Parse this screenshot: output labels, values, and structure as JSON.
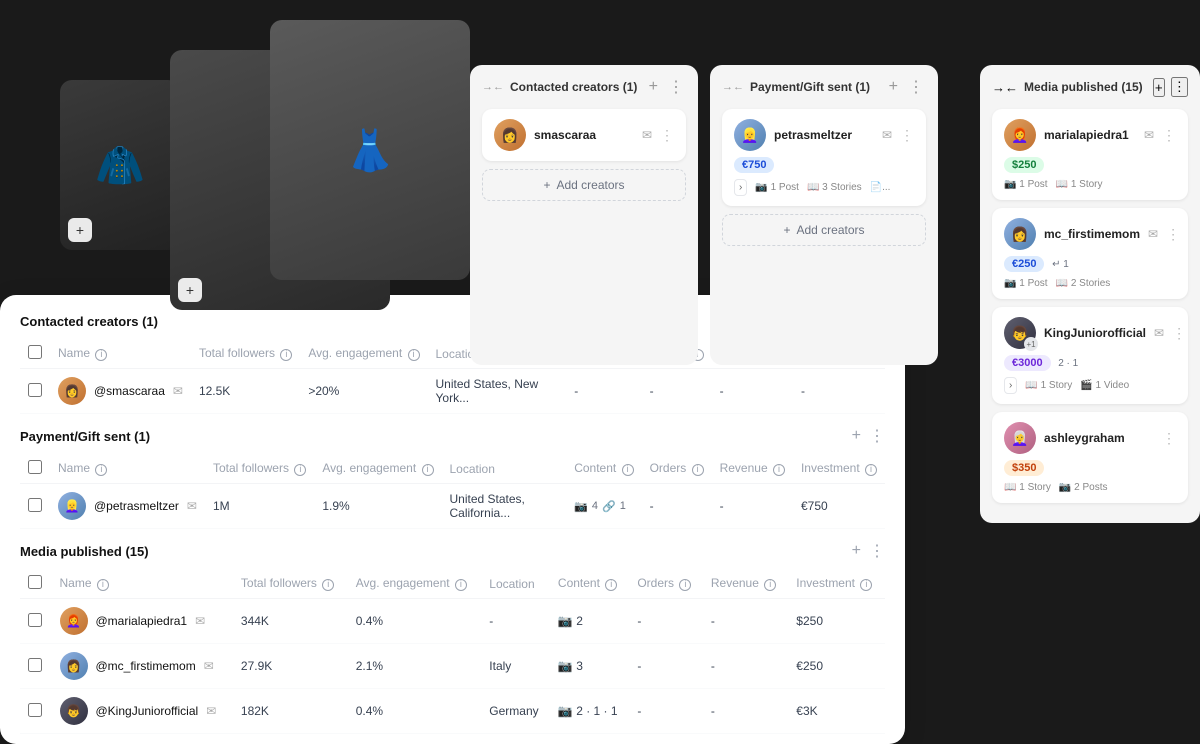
{
  "kanban": {
    "columns": [
      {
        "id": "contacted",
        "title": "Contacted creators (1)",
        "cards": [
          {
            "handle": "smascaraa",
            "avatarClass": "avatar-orange",
            "emoji": "👩"
          }
        ],
        "add_label": "Add creators"
      },
      {
        "id": "payment",
        "title": "Payment/Gift sent (1)",
        "cards": [
          {
            "handle": "petrasmeltzer",
            "avatarClass": "avatar-blue",
            "emoji": "👱‍♀️",
            "tag": "€750",
            "tagClass": "tag-blue",
            "meta": [
              "1 Post",
              "3 Stories"
            ]
          }
        ],
        "add_label": "Add creators"
      }
    ]
  },
  "right_panel": {
    "title": "Media published (15)",
    "cards": [
      {
        "handle": "marialapiedra1",
        "avatarClass": "avatar-orange",
        "emoji": "👩‍🦰",
        "tag": "$250",
        "tagClass": "tag-green",
        "meta": [
          "1 Post",
          "1 Story"
        ]
      },
      {
        "handle": "mc_firstimemom",
        "avatarClass": "avatar-blue",
        "emoji": "👩",
        "tag": "€250",
        "tagClass": "tag-blue",
        "badge": "1",
        "meta": [
          "1 Post",
          "2 Stories"
        ]
      },
      {
        "handle": "KingJuniorofficial",
        "avatarClass": "avatar-dark",
        "emoji": "👦",
        "tag": "€3000",
        "tagClass": "tag-purple",
        "counts": "2 · 1",
        "meta": [
          "1 Story",
          "1 Video"
        ]
      },
      {
        "handle": "ashleygraham",
        "avatarClass": "avatar-pink",
        "emoji": "👩‍🦳",
        "tag": "$350",
        "tagClass": "tag-orange",
        "meta": [
          "1 Story",
          "2 Posts"
        ]
      }
    ]
  },
  "table": {
    "sections": [
      {
        "title": "Contacted creators (1)",
        "rows": [
          {
            "handle": "@smascaraa",
            "followers": "12.5K",
            "engagement": ">20%",
            "location": "United States, New York...",
            "content": "-",
            "orders": "-",
            "revenue": "-",
            "investment": "-",
            "avatarClass": "avatar-orange",
            "emoji": "👩"
          }
        ]
      },
      {
        "title": "Payment/Gift sent (1)",
        "rows": [
          {
            "handle": "@petrasmeltzer",
            "followers": "1M",
            "engagement": "1.9%",
            "location": "United States, California...",
            "content": "4 · 1",
            "contentIcons": true,
            "orders": "-",
            "revenue": "-",
            "investment": "€750",
            "avatarClass": "avatar-blue",
            "emoji": "👱‍♀️"
          }
        ]
      },
      {
        "title": "Media published (15)",
        "rows": [
          {
            "handle": "@marialapiedra1",
            "followers": "344K",
            "engagement": "0.4%",
            "location": "-",
            "content": "2",
            "orders": "-",
            "revenue": "-",
            "investment": "$250",
            "avatarClass": "avatar-orange",
            "emoji": "👩‍🦰"
          },
          {
            "handle": "@mc_firstimemom",
            "followers": "27.9K",
            "engagement": "2.1%",
            "location": "Italy",
            "content": "3",
            "orders": "-",
            "revenue": "-",
            "investment": "€250",
            "avatarClass": "avatar-blue",
            "emoji": "👩"
          },
          {
            "handle": "@KingJuniorofficial",
            "followers": "182K",
            "engagement": "0.4%",
            "location": "Germany",
            "content": "2 · 1 · 1",
            "orders": "-",
            "revenue": "-",
            "investment": "€3K",
            "avatarClass": "avatar-dark",
            "emoji": "👦"
          }
        ]
      }
    ],
    "columns": [
      "Name",
      "Total followers",
      "Avg. engagement",
      "Location",
      "Content",
      "Orders",
      "Revenue",
      "Investment"
    ]
  },
  "photos": {
    "add_label": "+"
  }
}
